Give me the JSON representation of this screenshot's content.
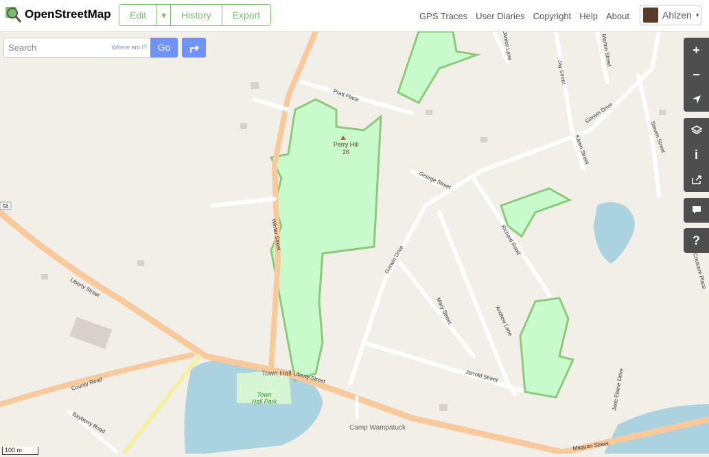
{
  "header": {
    "brand": "OpenStreetMap",
    "edit": "Edit",
    "edit_caret": "▾",
    "history": "History",
    "export": "Export",
    "nav": [
      "GPS Traces",
      "User Diaries",
      "Copyright",
      "Help",
      "About"
    ],
    "user": "Ahlzen",
    "user_caret": "▾"
  },
  "search": {
    "placeholder": "Search",
    "where": "Where am I?",
    "go": "Go"
  },
  "controls": {
    "zoom_in": "+",
    "zoom_out": "−",
    "info": "i",
    "help": "?"
  },
  "map": {
    "hill_name": "Perry Hill",
    "hill_elev": "26",
    "town_hall": "Town Hall",
    "park": "Town",
    "park2": "Hall Park",
    "camp": "Camp Wampatuck",
    "route_shield": "58",
    "streets": {
      "pratt": "Pratt Place",
      "winter": "Winter Street",
      "liberty1": "Liberty Street",
      "liberty2": "Liberty Street",
      "county": "County Road",
      "bayberry": "Bayberry Road",
      "george": "George Street",
      "gorwin1": "Gorwin Drive",
      "gorwin2": "Gorwin Drive",
      "jay": "Jay Street",
      "morton": "Morton Street",
      "karen": "Karen Street",
      "steven": "Steven Street",
      "richard": "Richard Road",
      "mary": "Mary Street",
      "andrew": "Andrew Lane",
      "jerrold": "Jerrold Street",
      "maquan": "Maquan Street",
      "crescent": "Crescent Place",
      "janice": "Janice Lane",
      "jane": "Jane Elaine Drive"
    }
  },
  "scale": {
    "metric": "100 m"
  }
}
